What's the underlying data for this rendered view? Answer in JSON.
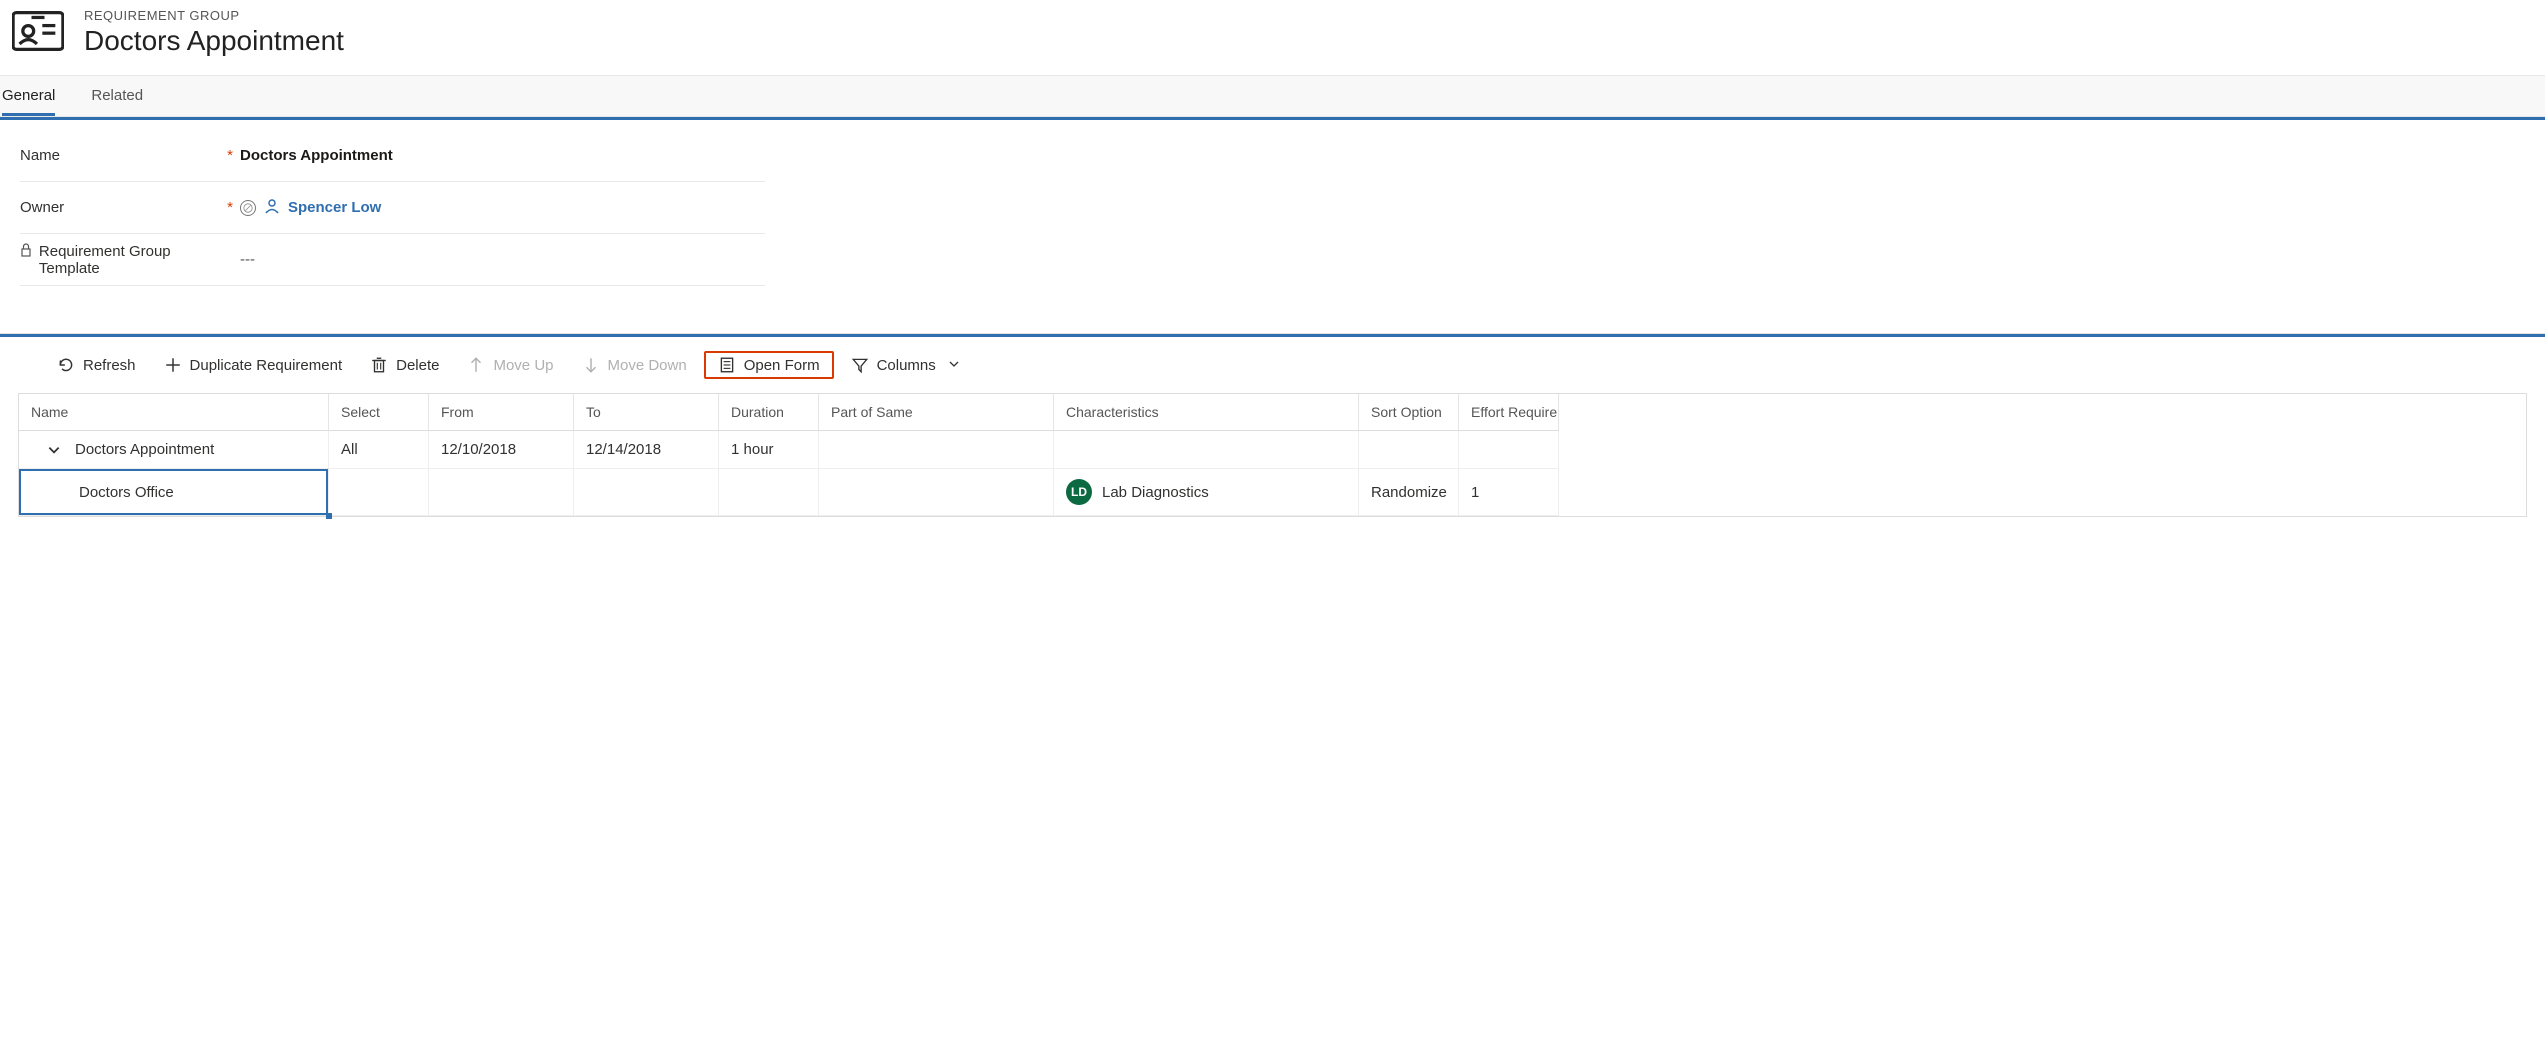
{
  "header": {
    "breadcrumb": "REQUIREMENT GROUP",
    "title": "Doctors Appointment"
  },
  "tabs": {
    "general": "General",
    "related": "Related"
  },
  "form": {
    "name_label": "Name",
    "name_value": "Doctors Appointment",
    "owner_label": "Owner",
    "owner_value": "Spencer Low",
    "template_label": "Requirement Group Template",
    "template_value": "---"
  },
  "toolbar": {
    "refresh": "Refresh",
    "duplicate": "Duplicate Requirement",
    "delete": "Delete",
    "moveup": "Move Up",
    "movedown": "Move Down",
    "openform": "Open Form",
    "columns": "Columns"
  },
  "grid": {
    "headers": {
      "name": "Name",
      "select": "Select",
      "from": "From",
      "to": "To",
      "duration": "Duration",
      "partofsame": "Part of Same",
      "characteristics": "Characteristics",
      "sortoption": "Sort Option",
      "effort": "Effort Require"
    },
    "rows": [
      {
        "name": "Doctors Appointment",
        "select": "All",
        "from": "12/10/2018",
        "to": "12/14/2018",
        "duration": "1 hour",
        "partofsame": "",
        "char_initials": "",
        "char_label": "",
        "sortoption": "",
        "effort": ""
      },
      {
        "name": "Doctors Office",
        "select": "",
        "from": "",
        "to": "",
        "duration": "",
        "partofsame": "",
        "char_initials": "LD",
        "char_label": "Lab Diagnostics",
        "sortoption": "Randomize",
        "effort": "1"
      }
    ]
  }
}
